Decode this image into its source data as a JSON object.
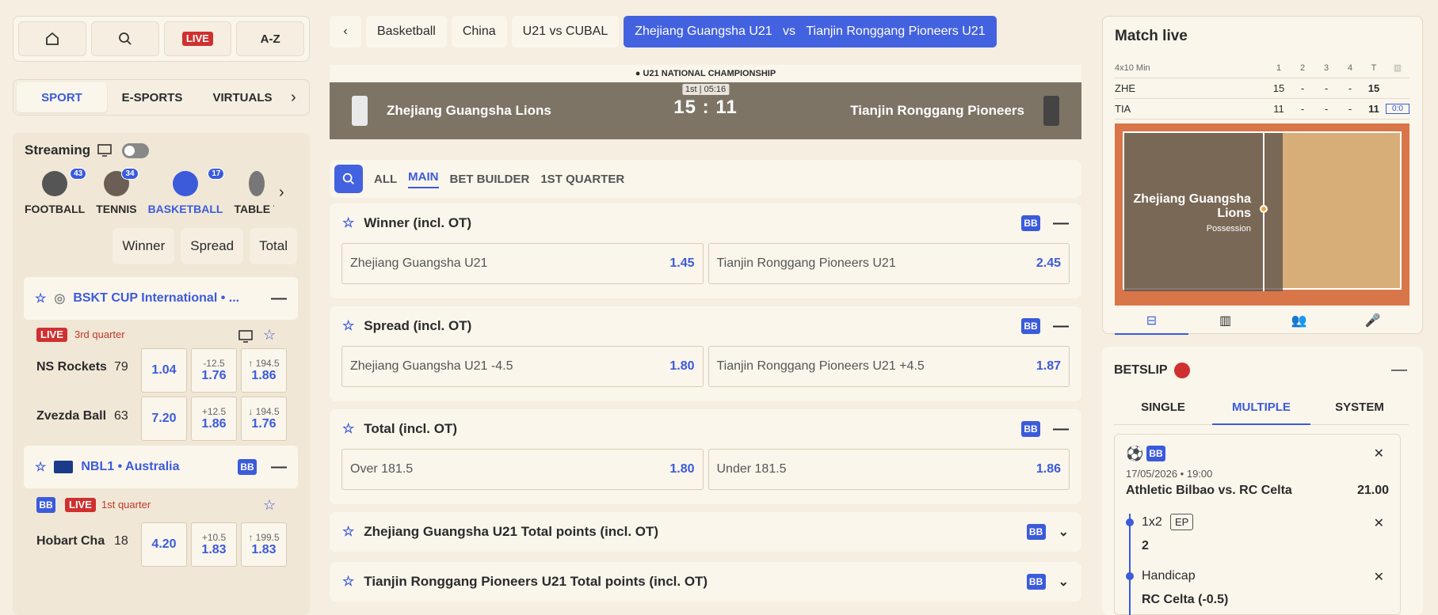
{
  "topnav": {
    "live": "LIVE",
    "az": "A-Z"
  },
  "sport_tabs": [
    "SPORT",
    "E-SPORTS",
    "VIRTUALS"
  ],
  "streaming": "Streaming",
  "sports": [
    {
      "label": "FOOTBALL",
      "count": "43",
      "color": "#555555"
    },
    {
      "label": "TENNIS",
      "count": "34",
      "color": "#6b5f55"
    },
    {
      "label": "BASKETBALL",
      "count": "17",
      "color": "#3b5bdb"
    },
    {
      "label": "TABLE T",
      "count": "",
      "color": "#777777"
    }
  ],
  "quick_bets": [
    "Winner",
    "Spread",
    "Total"
  ],
  "league1": "BSKT CUP International • ...",
  "match1": {
    "live": "LIVE",
    "period": "3rd quarter",
    "home": "NS Rockets",
    "home_score": "79",
    "home_odd": "1.04",
    "home_spread": "-12.5",
    "home_spread_odd": "1.76",
    "home_total": "194.5",
    "home_total_odd": "1.86",
    "away": "Zvezda Ball",
    "away_score": "63",
    "away_odd": "7.20",
    "away_spread": "+12.5",
    "away_spread_odd": "1.86",
    "away_total": "194.5",
    "away_total_odd": "1.76"
  },
  "league2": "NBL1 • Australia",
  "bb": "BB",
  "match2": {
    "live": "LIVE",
    "period": "1st quarter",
    "home": "Hobart Cha",
    "home_score": "18",
    "home_odd": "4.20",
    "home_spread": "+10.5",
    "home_spread_odd": "1.83",
    "home_total": "199.5",
    "home_total_odd": "1.83"
  },
  "crumbs": [
    "Basketball",
    "China",
    "U21 vs CUBAL"
  ],
  "crumb_active": {
    "home": "Zhejiang Guangsha U21",
    "vs": "vs",
    "away": "Tianjin Ronggang Pioneers U21"
  },
  "scoreboard": {
    "championship": "U21 NATIONAL CHAMPIONSHIP",
    "home": "Zhejiang Guangsha Lions",
    "away": "Tianjin Ronggang Pioneers",
    "period": "1st",
    "time": "05:16",
    "home_score": "15",
    "sep": ":",
    "away_score": "11"
  },
  "market_tabs": [
    "ALL",
    "MAIN",
    "BET BUILDER",
    "1ST QUARTER"
  ],
  "markets": [
    {
      "title": "Winner (incl. OT)",
      "sels": [
        {
          "n": "Zhejiang Guangsha U21",
          "o": "1.45"
        },
        {
          "n": "Tianjin Ronggang Pioneers U21",
          "o": "2.45"
        }
      ]
    },
    {
      "title": "Spread (incl. OT)",
      "sels": [
        {
          "n": "Zhejiang Guangsha U21 -4.5",
          "o": "1.80"
        },
        {
          "n": "Tianjin Ronggang Pioneers U21 +4.5",
          "o": "1.87"
        }
      ]
    },
    {
      "title": "Total (incl. OT)",
      "sels": [
        {
          "n": "Over 181.5",
          "o": "1.80"
        },
        {
          "n": "Under 181.5",
          "o": "1.86"
        }
      ]
    },
    {
      "title": "Zhejiang Guangsha U21 Total points (incl. OT)"
    },
    {
      "title": "Tianjin Ronggang Pioneers U21 Total points (incl. OT)"
    }
  ],
  "match_live": {
    "title": "Match live",
    "format": "4x10 Min",
    "cols": [
      "1",
      "2",
      "3",
      "4",
      "T"
    ],
    "rows": [
      {
        "team": "ZHE",
        "q": [
          "15",
          "-",
          "-",
          "-",
          "15"
        ]
      },
      {
        "team": "TIA",
        "q": [
          "11",
          "-",
          "-",
          "-",
          "11"
        ]
      }
    ],
    "possession_team": "Zhejiang Guangsha Lions",
    "possession": "Possession",
    "bonus": "0:0"
  },
  "betslip": {
    "title": "BETSLIP",
    "count": "",
    "tabs": [
      "SINGLE",
      "MULTIPLE",
      "SYSTEM"
    ],
    "date": "17/05/2026 • 19:00",
    "event": "Athletic Bilbao vs. RC Celta",
    "total_odd": "21.00",
    "leg1_market": "1x2",
    "leg1_tag": "EP",
    "leg1_pick": "2",
    "leg2_market": "Handicap",
    "leg2_pick": "RC Celta (-0.5)"
  }
}
